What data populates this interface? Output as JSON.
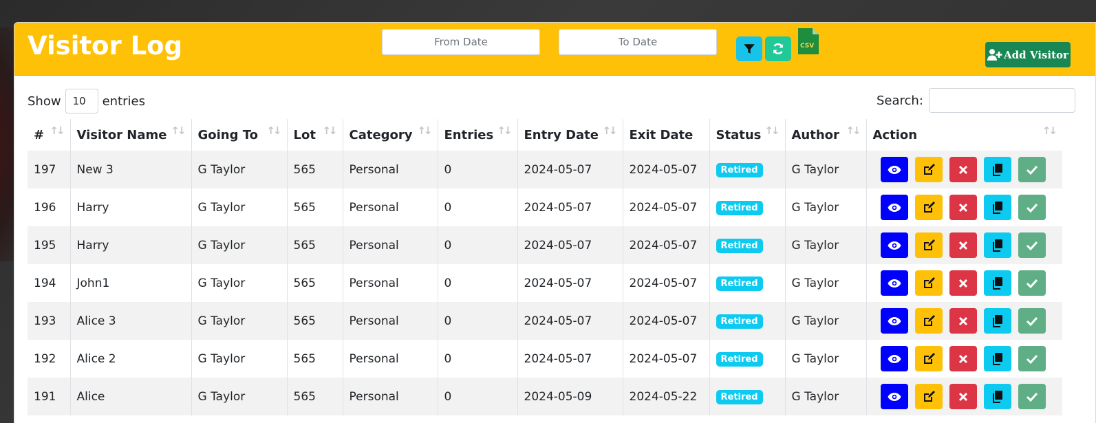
{
  "header": {
    "title": "Visitor Log",
    "from_date_placeholder": "From Date",
    "to_date_placeholder": "To Date",
    "csv_label": "CSV",
    "add_visitor_label": "Add Visitor"
  },
  "controls": {
    "show_label": "Show",
    "entries_value": "10",
    "entries_label": "entries",
    "search_label": "Search:"
  },
  "table": {
    "columns": [
      "#",
      "Visitor Name",
      "Going To",
      "Lot",
      "Category",
      "Entries",
      "Entry Date",
      "Exit Date",
      "Status",
      "Author",
      "Action"
    ],
    "rows": [
      {
        "id": "197",
        "name": "New 3",
        "going_to": "G Taylor",
        "lot": "565",
        "category": "Personal",
        "entries": "0",
        "entry_date": "2024-05-07",
        "exit_date": "2024-05-07",
        "status": "Retired",
        "author": "G Taylor"
      },
      {
        "id": "196",
        "name": "Harry",
        "going_to": "G Taylor",
        "lot": "565",
        "category": "Personal",
        "entries": "0",
        "entry_date": "2024-05-07",
        "exit_date": "2024-05-07",
        "status": "Retired",
        "author": "G Taylor"
      },
      {
        "id": "195",
        "name": "Harry",
        "going_to": "G Taylor",
        "lot": "565",
        "category": "Personal",
        "entries": "0",
        "entry_date": "2024-05-07",
        "exit_date": "2024-05-07",
        "status": "Retired",
        "author": "G Taylor"
      },
      {
        "id": "194",
        "name": "John1",
        "going_to": "G Taylor",
        "lot": "565",
        "category": "Personal",
        "entries": "0",
        "entry_date": "2024-05-07",
        "exit_date": "2024-05-07",
        "status": "Retired",
        "author": "G Taylor"
      },
      {
        "id": "193",
        "name": "Alice 3",
        "going_to": "G Taylor",
        "lot": "565",
        "category": "Personal",
        "entries": "0",
        "entry_date": "2024-05-07",
        "exit_date": "2024-05-07",
        "status": "Retired",
        "author": "G Taylor"
      },
      {
        "id": "192",
        "name": "Alice 2",
        "going_to": "G Taylor",
        "lot": "565",
        "category": "Personal",
        "entries": "0",
        "entry_date": "2024-05-07",
        "exit_date": "2024-05-07",
        "status": "Retired",
        "author": "G Taylor"
      },
      {
        "id": "191",
        "name": "Alice",
        "going_to": "G Taylor",
        "lot": "565",
        "category": "Personal",
        "entries": "0",
        "entry_date": "2024-05-09",
        "exit_date": "2024-05-22",
        "status": "Retired",
        "author": "G Taylor"
      }
    ],
    "row_actions": [
      "eye-icon",
      "edit-icon",
      "close-icon",
      "copy-icon",
      "check-icon"
    ]
  },
  "colors": {
    "header_bg": "#ffc107",
    "add_button": "#198754",
    "status_badge": "#0dcaf0",
    "view": "#0000ff",
    "edit": "#ffc107",
    "delete": "#dc3545",
    "copy": "#0dcaf0",
    "approve": "#5fae86"
  }
}
